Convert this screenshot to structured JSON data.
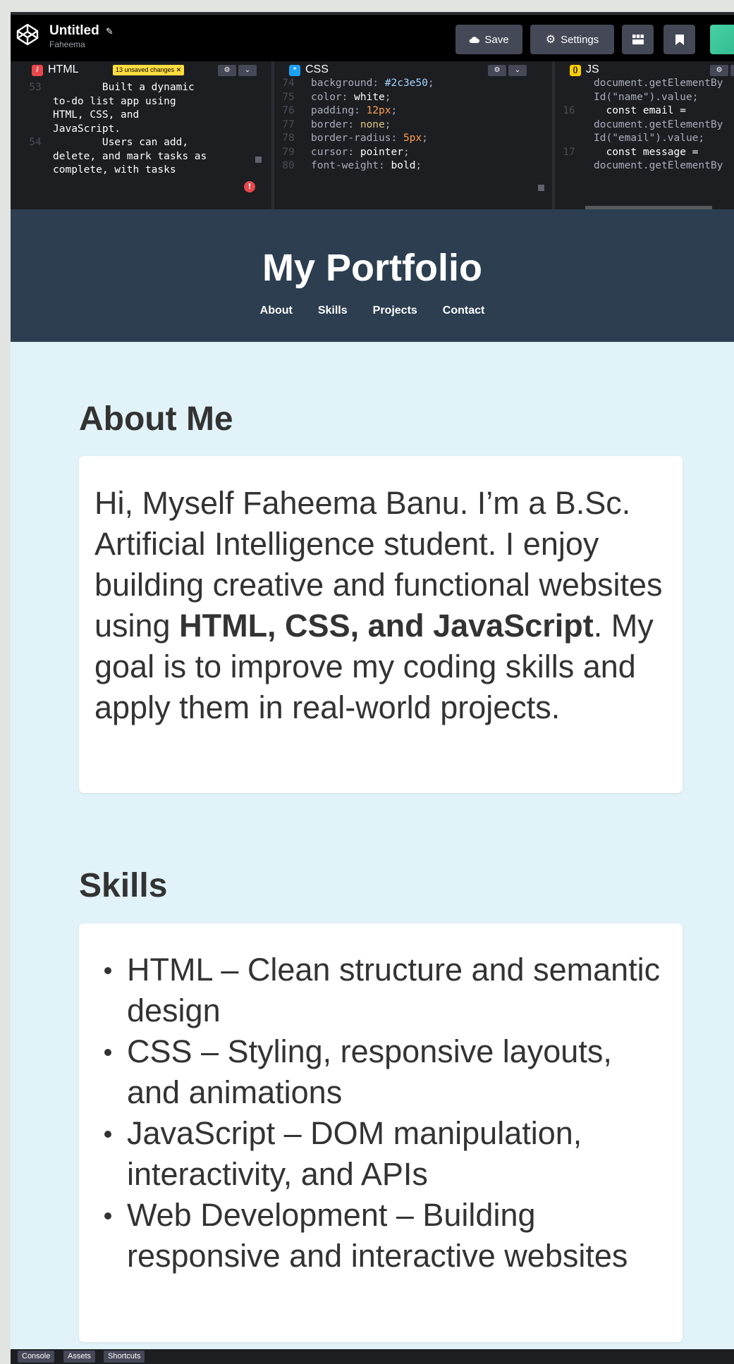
{
  "topbar": {
    "project_title": "Untitled",
    "user": "Faheema",
    "save_label": "Save",
    "settings_label": "Settings"
  },
  "editors": {
    "html": {
      "label": "HTML",
      "badge_text": "13 unsaved changes ✕",
      "lines": [
        {
          "ln": "53",
          "text": "        Built a dynamic"
        },
        {
          "ln": "",
          "text": "to-do list app using"
        },
        {
          "ln": "",
          "text": "HTML, CSS, and"
        },
        {
          "ln": "",
          "text": "JavaScript."
        },
        {
          "ln": "54",
          "text": "        Users can add,"
        },
        {
          "ln": "",
          "text": "delete, and mark tasks as"
        },
        {
          "ln": "",
          "text": "complete, with tasks"
        }
      ]
    },
    "css": {
      "label": "CSS",
      "lines": [
        {
          "ln": "74",
          "prop": "background: ",
          "val": "#2c3e50",
          "kind": "str"
        },
        {
          "ln": "75",
          "prop": "color: ",
          "val": "white",
          "kind": "plain"
        },
        {
          "ln": "76",
          "prop": "padding: ",
          "val": "12px",
          "kind": "num"
        },
        {
          "ln": "77",
          "prop": "border: ",
          "val": "none",
          "kind": "kw"
        },
        {
          "ln": "78",
          "prop": "border-radius: ",
          "val": "5px",
          "kind": "num"
        },
        {
          "ln": "79",
          "prop": "cursor: ",
          "val": "pointer",
          "kind": "plain"
        },
        {
          "ln": "80",
          "prop": "font-weight: ",
          "val": "bold",
          "kind": "plain"
        }
      ]
    },
    "js": {
      "label": "JS",
      "lines": [
        {
          "ln": "",
          "text": "document.getElementBy"
        },
        {
          "ln": "",
          "text": "Id(\"name\").value;"
        },
        {
          "ln": "16",
          "text": "  const email ="
        },
        {
          "ln": "",
          "text": "document.getElementBy"
        },
        {
          "ln": "",
          "text": "Id(\"email\").value;"
        },
        {
          "ln": "17",
          "text": "  const message ="
        },
        {
          "ln": "",
          "text": "document.getElementBy"
        }
      ]
    }
  },
  "preview": {
    "site_title": "My Portfolio",
    "nav": [
      "About",
      "Skills",
      "Projects",
      "Contact"
    ],
    "about": {
      "heading": "About Me",
      "text_before": "Hi, Myself Faheema Banu. I’m a B.Sc. Artificial Intelligence student. I enjoy building creative and functional websites using ",
      "text_bold1": "HTML, CSS, and JavaScript",
      "text_after": ". My goal is to improve my coding skills and apply them in real-world projects."
    },
    "skills": {
      "heading": "Skills",
      "items": [
        "HTML – Clean structure and semantic design",
        "CSS – Styling, responsive layouts, and animations",
        "JavaScript – DOM manipulation, interactivity, and APIs",
        "Web Development – Building responsive and interactive websites"
      ]
    }
  },
  "bottombar": {
    "console_label": "Console",
    "assets_label": "Assets",
    "shortcuts_label": "Shortcuts"
  },
  "colors": {
    "header_bg": "#2c3e50",
    "preview_bg": "#e1f3f8",
    "html_icon": "#e8474c",
    "css_icon": "#1da1f2",
    "js_icon": "#fcd000",
    "unsaved_badge": "#ffdd40"
  },
  "icons": {
    "logo": "codepen-logo-icon",
    "pencil": "pencil-icon",
    "save": "cloud-icon",
    "settings": "gear-icon",
    "layout": "layout-icon",
    "bookmark": "bookmark-icon"
  }
}
